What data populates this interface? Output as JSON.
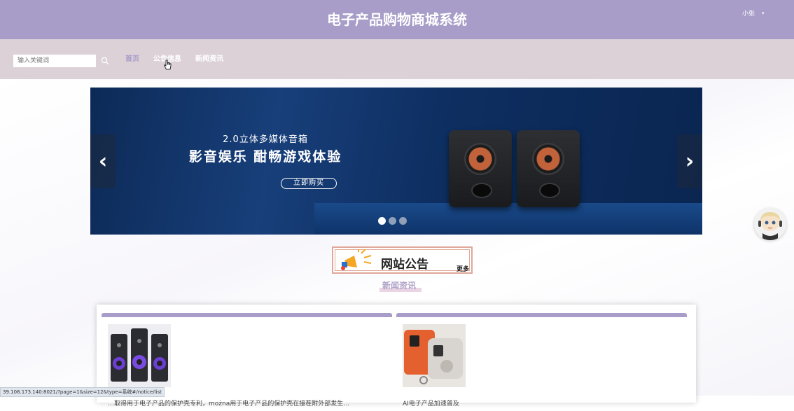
{
  "header": {
    "title": "电子产品购物商城系统",
    "user_name": "小张",
    "user_caret": "▾"
  },
  "nav": {
    "search_placeholder": "输入关键词",
    "items": [
      {
        "label": "首页",
        "active": true
      },
      {
        "label": "公告信息",
        "active": false
      },
      {
        "label": "新闻资讯",
        "active": false
      }
    ]
  },
  "banner": {
    "line1": "2.0立体多媒体音箱",
    "line2": "影音娱乐  酣畅游戏体验",
    "button": "立即购买",
    "prev_icon": "‹",
    "next_icon": "›",
    "slide_count": 3,
    "active_slide": 1
  },
  "notice": {
    "title": "网站公告",
    "more": "更多"
  },
  "news": {
    "section_title": "新闻资讯",
    "cards": [
      {
        "text": "…取得用于电子产品的保护壳专利，można用于电子产品的保护壳在接茬附外部发生…"
      },
      {
        "text": "AI电子产品加速普及"
      }
    ]
  },
  "status_bar": {
    "url": "39.108.173.140:8021/?page=1&size=12&type=系统#/notice/list"
  },
  "colors": {
    "header_bg": "#a79dc8",
    "nav_bg": "#dcd1d7",
    "accent": "#a79dc8"
  }
}
